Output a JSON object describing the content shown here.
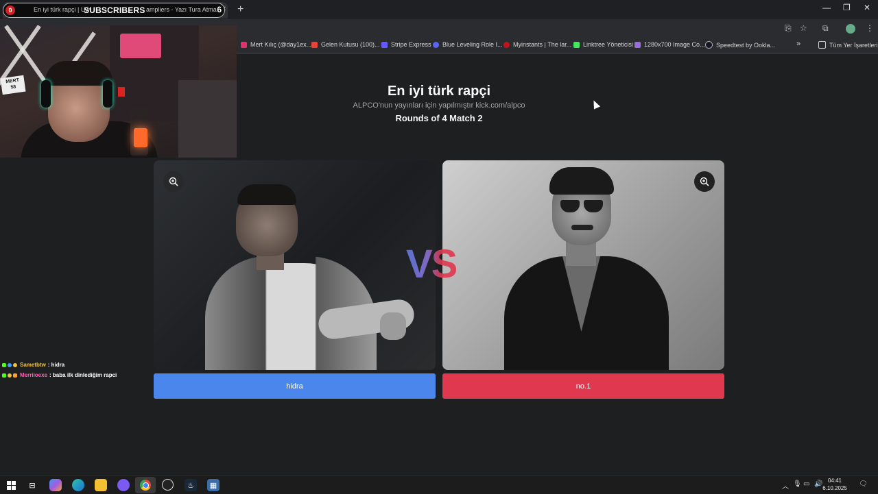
{
  "browser": {
    "tab_title_start": "En iyi türk rapçi | Uw",
    "tab_title_end": "ampliers - Yazı Tura Atma",
    "overlay_badge": "0",
    "overlay_label": "SUBSCRIBERS",
    "overlay_count": "6",
    "tab_favicon_letter": "U",
    "tab_close": "✕",
    "new_tab": "+",
    "window_controls": [
      "—",
      "❐",
      "✕"
    ],
    "bookmarks": [
      {
        "label": "Mert Kılıç (@day1ex...",
        "color": "#e1306c"
      },
      {
        "label": "Gelen Kutusu (100)...",
        "color": "#ea4335"
      },
      {
        "label": "Stripe Express",
        "color": "#635bff"
      },
      {
        "label": "Blue Leveling Role I...",
        "color": "#5865f2"
      },
      {
        "label": "Myinstants | The lar...",
        "color": "#c0141b"
      },
      {
        "label": "Linktree Yöneticisi",
        "color": "#43e55e"
      },
      {
        "label": "1280x700 Image Co...",
        "color": "#9b6be0"
      },
      {
        "label": "Speedtest by Ookla...",
        "color": "#141526"
      }
    ],
    "bookmarks_overflow": "»",
    "all_bookmarks": "Tüm Yer İşaretleri"
  },
  "webcam": {
    "sign_line1": "MERT",
    "sign_line2": "58"
  },
  "page": {
    "title": "En iyi türk rapçi",
    "subtitle": "ALPCO'nun yayınları için yapılmıştır kick.com/alpco",
    "round_info": "Rounds of 4 Match 2",
    "vs_text": "VS",
    "left_option": "hidra",
    "right_option": "no.1"
  },
  "chat": [
    {
      "user": "Sametbtw",
      "message": ": hidra",
      "color": "#f0c040"
    },
    {
      "user": "Merriioexe",
      "message": ": baba ilk dinlediğim rapci",
      "color": "#ff5db1"
    }
  ],
  "taskbar": {
    "time": "04:41",
    "date": "6.10.2025"
  }
}
